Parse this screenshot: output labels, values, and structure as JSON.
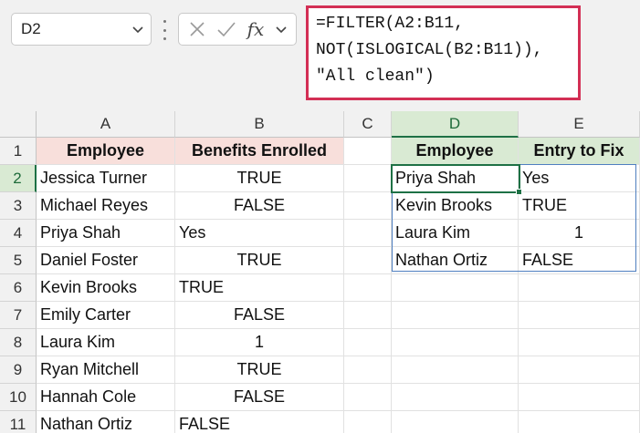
{
  "name_box": {
    "value": "D2"
  },
  "formula_bar": {
    "lines": [
      "=FILTER(A2:B11,",
      "NOT(ISLOGICAL(B2:B11)),",
      "\"All clean\")"
    ],
    "accent_color": "#d32f55"
  },
  "icons": {
    "cancel": "close-icon",
    "enter": "check-icon",
    "function": "fx-icon"
  },
  "fx_label": "fx",
  "columns": [
    "A",
    "B",
    "C",
    "D",
    "E"
  ],
  "rows": [
    "1",
    "2",
    "3",
    "4",
    "5",
    "6",
    "7",
    "8",
    "9",
    "10",
    "11"
  ],
  "table_left": {
    "headers": [
      "Employee",
      "Benefits Enrolled"
    ],
    "header_color": "#f8dfdb",
    "rows": [
      [
        "Jessica Turner",
        "TRUE"
      ],
      [
        "Michael Reyes",
        "FALSE"
      ],
      [
        "Priya Shah",
        "Yes"
      ],
      [
        "Daniel Foster",
        "TRUE"
      ],
      [
        "Kevin Brooks",
        "TRUE"
      ],
      [
        "Emily Carter",
        "FALSE"
      ],
      [
        "Laura Kim",
        "1"
      ],
      [
        "Ryan Mitchell",
        "TRUE"
      ],
      [
        "Hannah Cole",
        "FALSE"
      ],
      [
        "Nathan Ortiz",
        "FALSE"
      ]
    ]
  },
  "table_right": {
    "headers": [
      "Employee",
      "Entry to Fix"
    ],
    "header_color": "#d9ead3",
    "rows": [
      [
        "Priya Shah",
        "Yes"
      ],
      [
        "Kevin Brooks",
        "TRUE"
      ],
      [
        "Laura Kim",
        "1"
      ],
      [
        "Nathan Ortiz",
        "FALSE"
      ]
    ]
  },
  "selected_cell": "D2"
}
